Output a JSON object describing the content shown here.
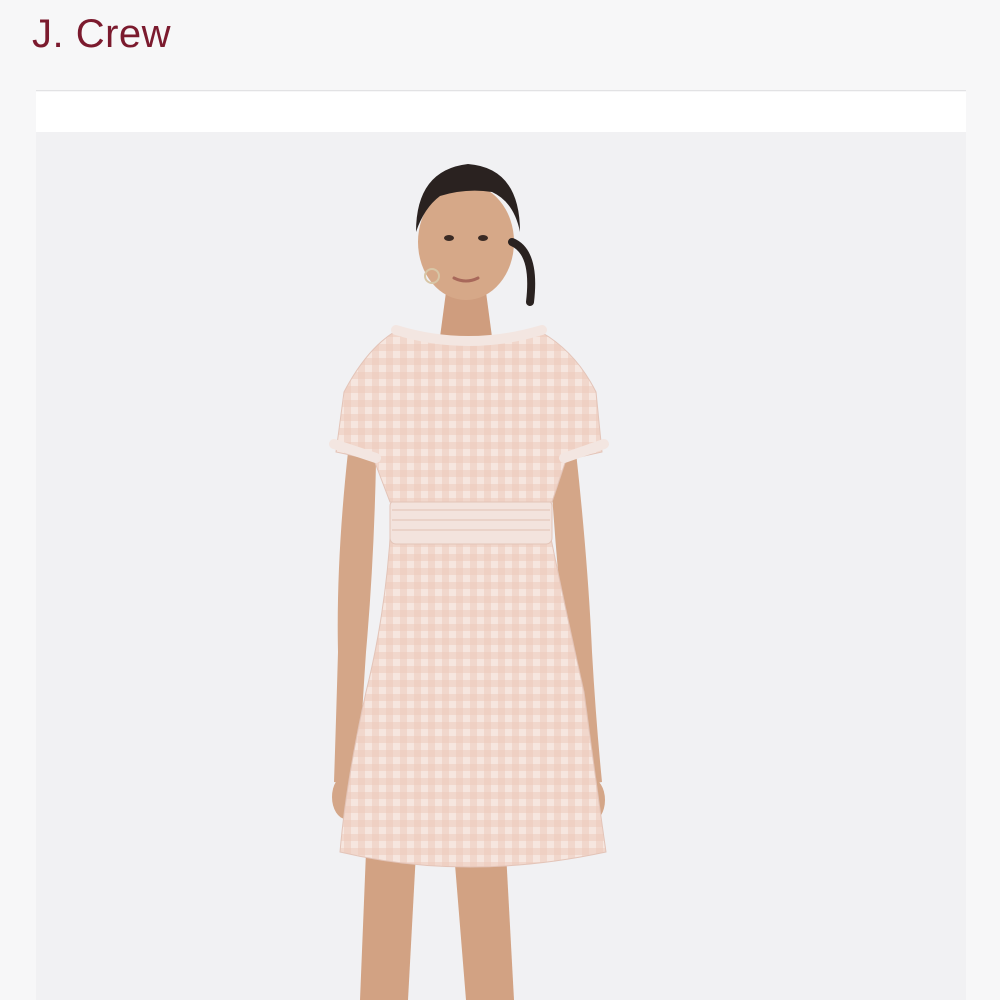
{
  "header": {
    "brand": "J. Crew"
  },
  "product": {
    "colors": {
      "brand": "#7b1a2e",
      "dress": "#f2dcd4",
      "gingham": "#e6bfb2",
      "skin": "#d6a888",
      "hair": "#2a2220",
      "background": "#f1f1f3"
    }
  }
}
